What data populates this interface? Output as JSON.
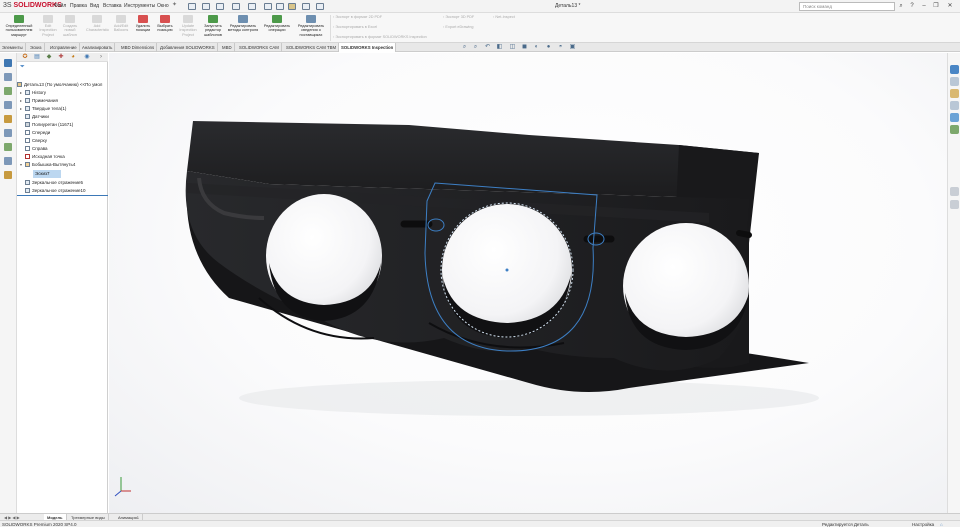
{
  "app": {
    "brand": "SOLIDWORKS",
    "brand_prefix": "3S",
    "document_title": "Деталь13 *"
  },
  "menu": [
    "Файл",
    "Правка",
    "Вид",
    "Вставка",
    "Инструменты",
    "Окно"
  ],
  "search": {
    "placeholder": "Поиск команд"
  },
  "ribbon": {
    "buttons": [
      {
        "label": "Определенный пользователем маршрут",
        "enabled": true
      },
      {
        "label": "Edit Inspection Project",
        "enabled": false
      },
      {
        "label": "Создать новый шаблон",
        "enabled": false
      },
      {
        "label": "Add Characteristic",
        "enabled": false
      },
      {
        "label": "Add/Edit Balloons",
        "enabled": false
      },
      {
        "label": "Удалить позиции",
        "enabled": true
      },
      {
        "label": "Выбрать позицию",
        "enabled": true
      },
      {
        "label": "Update Inspection Project",
        "enabled": false
      },
      {
        "label": "Запустить редактор шаблонов",
        "enabled": true
      },
      {
        "label": "Редактировать методы контроля",
        "enabled": true
      },
      {
        "label": "Редактировать операции",
        "enabled": true
      },
      {
        "label": "Редактировать сведения о поставщиках",
        "enabled": true
      }
    ],
    "exports_col1": [
      "Экспорт в формат 2D PDF",
      "Экспортировать в Excel",
      "Экспортировать в формат SOLIDWORKS Inspection"
    ],
    "exports_col2": [
      "Экспорт 3D PDF",
      "Export eDrawing"
    ],
    "exports_col3": [
      "Net-Inspect"
    ]
  },
  "command_tabs": [
    "Элементы",
    "Эскиз",
    "Исправление",
    "Анализировать",
    "MBD Dimensions",
    "Добавления SOLIDWORKS",
    "MBD",
    "SOLIDWORKS CAM",
    "SOLIDWORKS CAM TBM",
    "SOLIDWORKS Inspection"
  ],
  "active_command_tab": "SOLIDWORKS Inspection",
  "feature_tree": {
    "root": "Деталь13 (По умолчанию) <<По умол",
    "items": [
      {
        "label": "History",
        "expandable": true
      },
      {
        "label": "Примечания",
        "expandable": true
      },
      {
        "label": "Твердые тела(1)",
        "expandable": true
      },
      {
        "label": "Датчики",
        "expandable": false
      },
      {
        "label": "Полиуретан (11671)",
        "expandable": false
      },
      {
        "label": "Спереди",
        "expandable": false
      },
      {
        "label": "Сверху",
        "expandable": false
      },
      {
        "label": "Справа",
        "expandable": false
      },
      {
        "label": "Исходная точка",
        "expandable": false
      },
      {
        "label": "Бобышка-Вытянуть4",
        "expandable": true
      },
      {
        "label": "Эскиз7",
        "expandable": false,
        "selected": true
      },
      {
        "label": "Зеркальное отражение5",
        "expandable": false
      },
      {
        "label": "Зеркальное отражение10",
        "expandable": false
      }
    ]
  },
  "bottom_tabs": [
    "Модель",
    "Трехмерные виды",
    "Анимация1"
  ],
  "active_bottom_tab": "Модель",
  "status": {
    "version": "SOLIDWORKS Premium 2020 SP4.0",
    "mode": "Редактируется Деталь",
    "custom": "Настройка"
  },
  "colors": {
    "accent": "#c8102e",
    "selection": "#3b78b7",
    "model": "#1c1c1e"
  }
}
